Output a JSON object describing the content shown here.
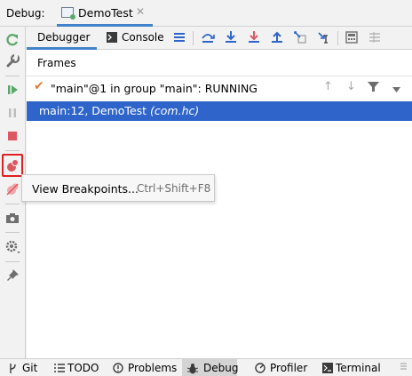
{
  "title_bar": {
    "label": "Debug:",
    "tab_label": "DemoTest"
  },
  "toolbar": {
    "debugger_tab": "Debugger",
    "console_tab": "Console"
  },
  "frames": {
    "header": "Frames",
    "thread": "\"main\"@1 in group \"main\": RUNNING",
    "selected_frame": {
      "location": "main:12, DemoTest ",
      "package": "(com.hc)"
    }
  },
  "tooltip": {
    "action": "View Breakpoints...",
    "shortcut": "Ctrl+Shift+F8"
  },
  "bottom_bar": {
    "items": [
      "Git",
      "TODO",
      "Problems",
      "Debug",
      "Profiler",
      "Terminal"
    ],
    "active": "Debug"
  },
  "colors": {
    "accent": "#4083c9",
    "selection": "#2f65ca",
    "stop_red": "#db5860",
    "run_green": "#59a869"
  }
}
